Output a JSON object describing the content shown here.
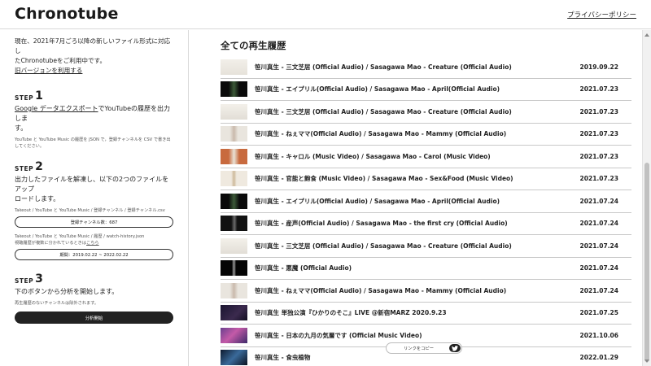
{
  "header": {
    "logo": "Chronotube",
    "privacy_link": "プライバシーポリシー"
  },
  "sidebar": {
    "intro_line1": "現在、2021年7月ごろ以降の新しいファイル形式に対応し",
    "intro_line2": "たChronotubeをご利用中です。",
    "old_version_link": "旧バージョンを利用する",
    "step_word": "STEP",
    "step1": {
      "num": "1",
      "link_text": "Google データエクスポート",
      "text_rest1": "でYouTubeの履歴を出力しま",
      "text_rest2": "す。",
      "note": "YouTube と YouTube Music の履歴を JSON で，登録チャンネルを CSV で書き出してください。"
    },
    "step2": {
      "num": "2",
      "text_line1": "出力したファイルを解凍し、以下の2つのファイルをアップ",
      "text_line2": "ロードします。",
      "file1_path": "Takeout / YouTube と YouTube Music / 登録チャンネル / 登録チャンネル.csv",
      "file1_button": "登録チャンネル数：687",
      "file2_path": "Takeout / YouTube と YouTube Music / 履歴 / watch-history.json",
      "file2_note_prefix": "視聴履歴が複数に分かれているときは",
      "file2_note_link": "こちら",
      "file2_button": "期間：2019.02.22 ~ 2022.02.22"
    },
    "step3": {
      "num": "3",
      "text": "下のボタンから分析を開始します。",
      "note": "再生履歴のないチャンネルは除外されます。",
      "start_button": "分析開始"
    }
  },
  "main": {
    "title": "全ての再生履歴",
    "rows": [
      {
        "title": "笹川真生 - 三文芝居 (Official Audio) / Sasagawa Mao - Creature (Official Audio)",
        "date": "2019.09.22"
      },
      {
        "title": "笹川真生 - エイプリル(Official Audio) / Sasagawa Mao - April(Official Audio)",
        "date": "2021.07.23"
      },
      {
        "title": "笹川真生 - 三文芝居 (Official Audio) / Sasagawa Mao - Creature (Official Audio)",
        "date": "2021.07.23"
      },
      {
        "title": "笹川真生 - ねぇママ(Official Audio) / Sasagawa Mao - Mammy (Official Audio)",
        "date": "2021.07.23"
      },
      {
        "title": "笹川真生 - キャロル (Music Video) / Sasagawa Mao - Carol (Music Video)",
        "date": "2021.07.23"
      },
      {
        "title": "笹川真生 - 官能と飽食 (Music Video) / Sasagawa Mao - Sex&Food (Music Video)",
        "date": "2021.07.23"
      },
      {
        "title": "笹川真生 - エイプリル(Official Audio) / Sasagawa Mao - April(Official Audio)",
        "date": "2021.07.24"
      },
      {
        "title": "笹川真生 - 産声(Official Audio) / Sasagawa Mao - the first cry (Official Audio)",
        "date": "2021.07.24"
      },
      {
        "title": "笹川真生 - 三文芝居 (Official Audio) / Sasagawa Mao - Creature (Official Audio)",
        "date": "2021.07.24"
      },
      {
        "title": "笹川真生 - 悪魔 (Official Audio)",
        "date": "2021.07.24"
      },
      {
        "title": "笹川真生 - ねぇママ(Official Audio) / Sasagawa Mao - Mammy (Official Audio)",
        "date": "2021.07.24"
      },
      {
        "title": "笹川真生 単独公演『ひかりのそこ』LIVE @新宿MARZ 2020.9.23",
        "date": "2021.07.25"
      },
      {
        "title": "笹川真生 - 日本の九月の気層です (Official Music Video)",
        "date": "2021.10.06"
      },
      {
        "title": "笹川真生 - 食虫植物",
        "date": "2022.01.29"
      }
    ]
  },
  "share": {
    "label": "リンクをコピー"
  },
  "colors": {
    "accent": "#222222",
    "divider": "#c8c8c8"
  }
}
